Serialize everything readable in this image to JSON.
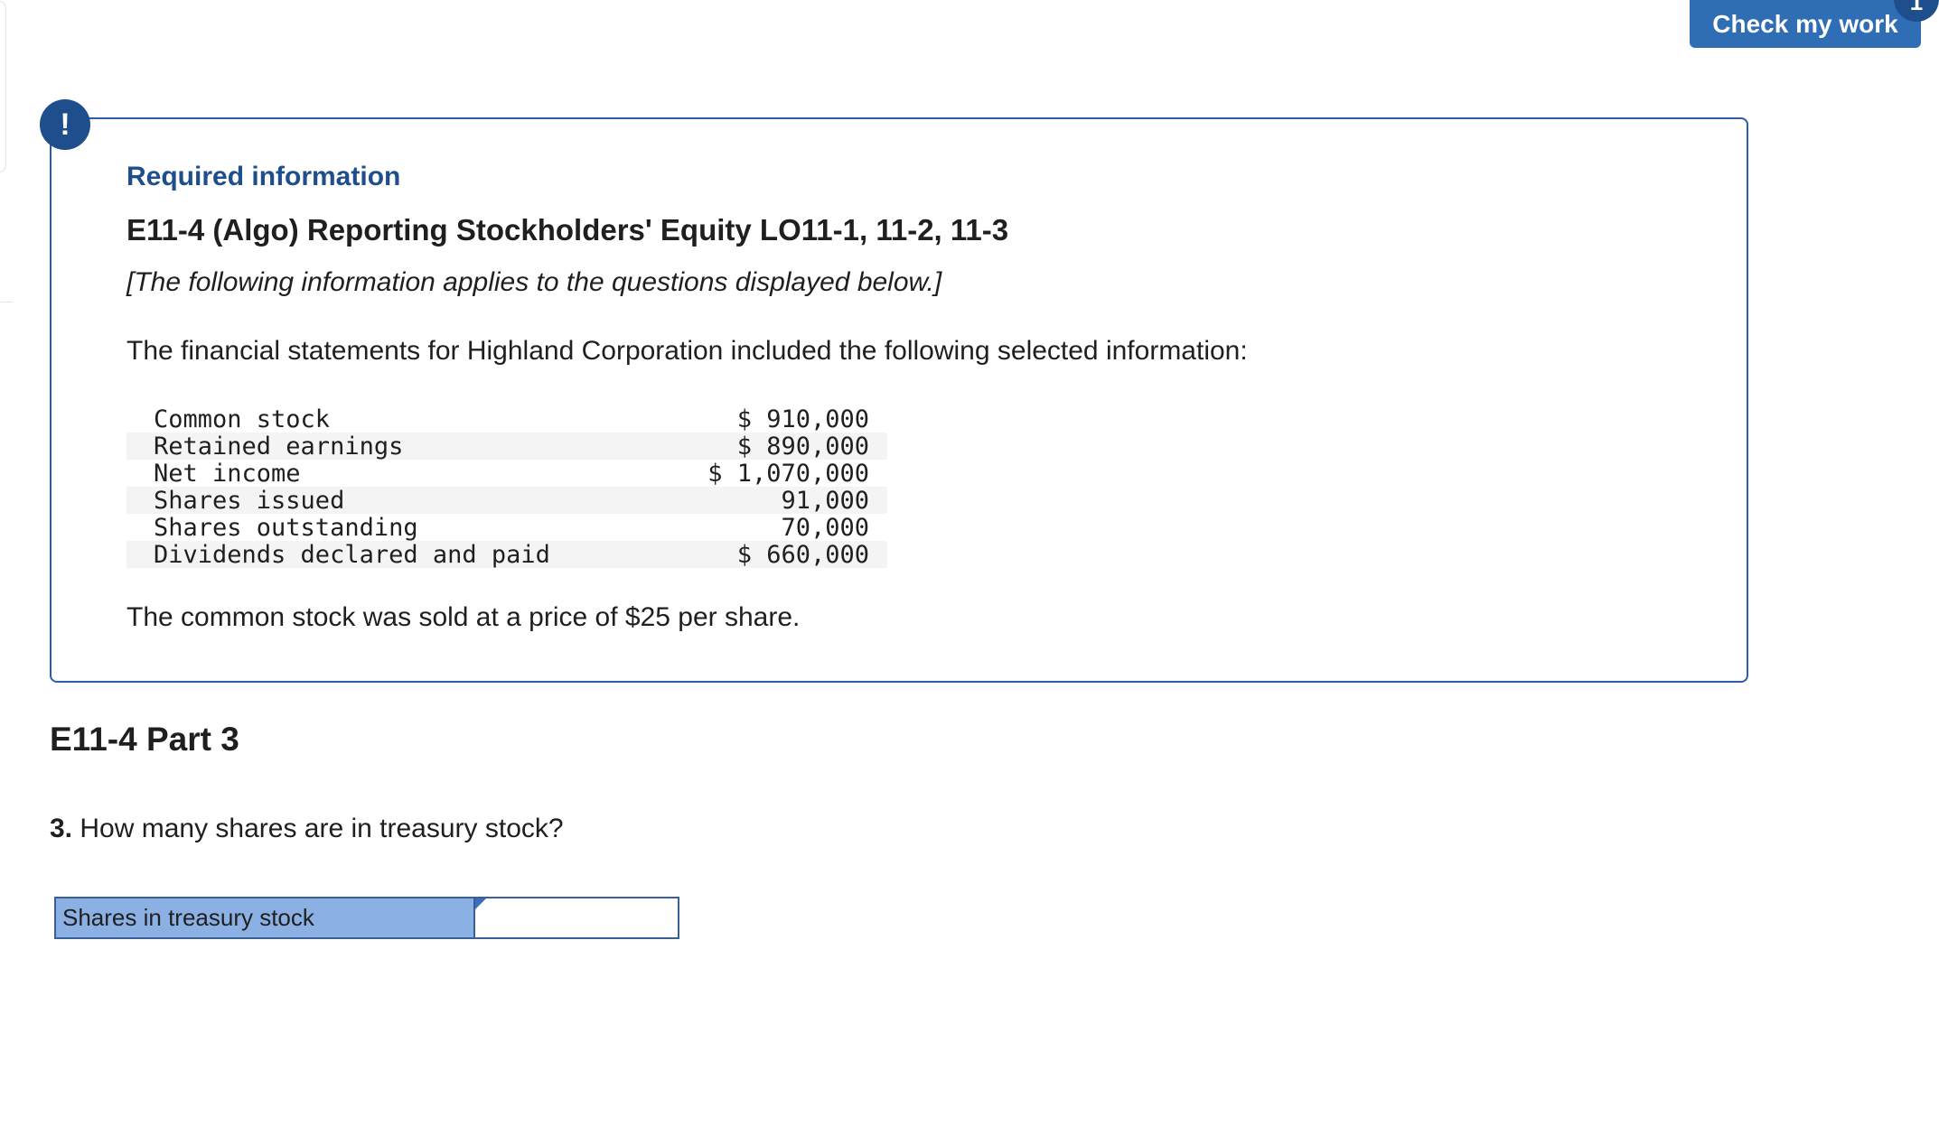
{
  "header": {
    "check_button_label": "Check my work",
    "badge_label": "1"
  },
  "alert": {
    "icon_glyph": "!"
  },
  "info": {
    "required_label": "Required information",
    "title": "E11-4 (Algo) Reporting Stockholders' Equity LO11-1, 11-2, 11-3",
    "note": "[The following information applies to the questions displayed below.]",
    "intro": "The financial statements for Highland Corporation included the following selected information:",
    "rows": [
      {
        "label": "Common stock",
        "value": "$ 910,000"
      },
      {
        "label": "Retained earnings",
        "value": "$ 890,000"
      },
      {
        "label": "Net income",
        "value": "$ 1,070,000"
      },
      {
        "label": "Shares issued",
        "value": "91,000"
      },
      {
        "label": "Shares outstanding",
        "value": "70,000"
      },
      {
        "label": "Dividends declared and paid",
        "value": "$ 660,000"
      }
    ],
    "price_note": "The common stock was sold at a price of $25 per share."
  },
  "part": {
    "heading": "E11-4 Part 3",
    "question_number": "3.",
    "question_text": "How many shares are in treasury stock?",
    "answer_label": "Shares in treasury stock",
    "answer_value": ""
  },
  "colors": {
    "accent": "#2f6db5",
    "brand_dark": "#1f4e8c",
    "answer_label_bg": "#8bb0e3"
  }
}
